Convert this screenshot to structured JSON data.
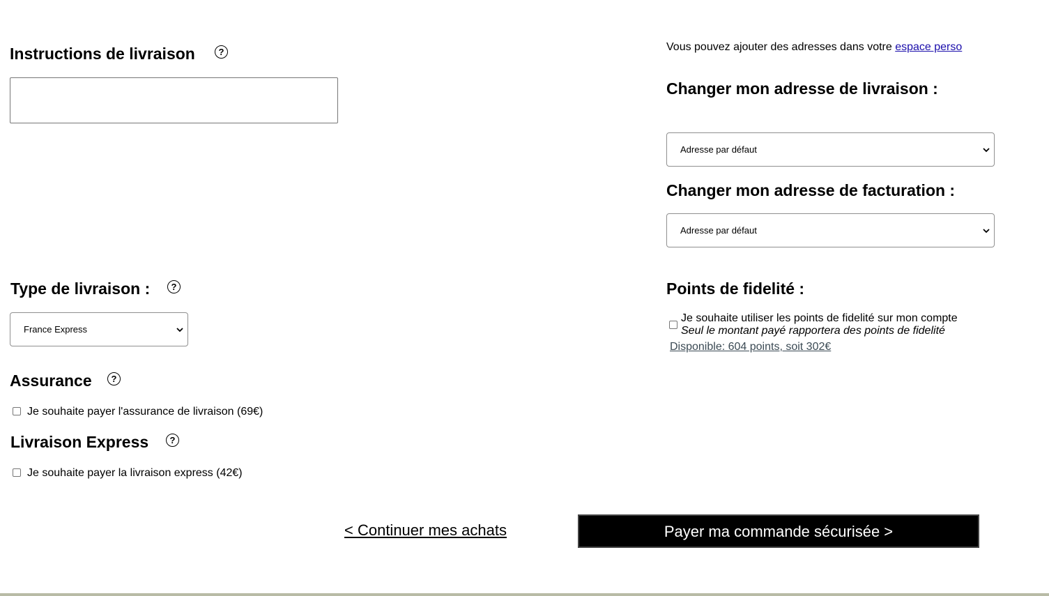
{
  "left": {
    "instructions": {
      "title": "Instructions de livraison",
      "help_icon": "help-circle-icon",
      "value": "",
      "placeholder": ""
    },
    "delivery_type": {
      "title": "Type de livraison :",
      "help_icon": "help-circle-icon",
      "selected": "France Express"
    },
    "insurance": {
      "title": "Assurance",
      "help_icon": "help-circle-icon",
      "checkbox_label": "Je souhaite payer l'assurance de livraison (69€)",
      "checked": false
    },
    "express": {
      "title": "Livraison Express",
      "help_icon": "help-circle-icon",
      "checkbox_label": "Je souhaite payer la livraison express (42€)",
      "checked": false
    }
  },
  "right": {
    "address_note": {
      "text": "Vous pouvez ajouter des adresses dans votre",
      "link": "espace perso"
    },
    "shipping_address": {
      "title": "Changer mon adresse de livraison :",
      "selected": "Adresse par défaut"
    },
    "billing_address": {
      "title": "Changer mon adresse de facturation :",
      "selected": "Adresse par défaut"
    },
    "loyalty": {
      "title": "Points de fidelité :",
      "checkbox_label": "Je souhaite utiliser les points de fidelité sur mon compte",
      "note": "Seul le montant payé rapportera des points de fidelité",
      "available": "Disponible: 604 points, soit 302€",
      "checked": false
    }
  },
  "actions": {
    "continue": "< Continuer mes achats",
    "pay": "Payer ma commande sécurisée >"
  },
  "colors": {
    "pay_button_bg": "#000000",
    "bottom_bar": "#b8bba6"
  }
}
